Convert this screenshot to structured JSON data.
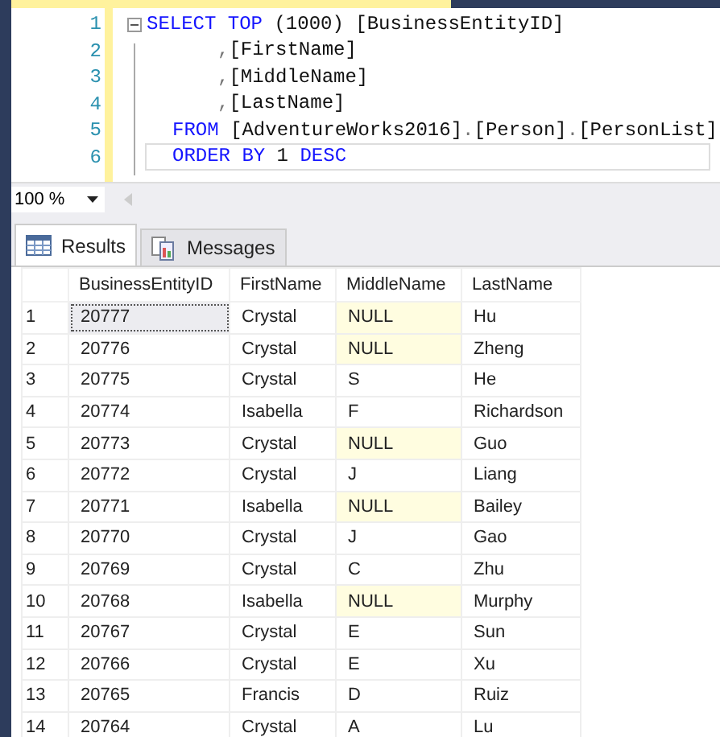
{
  "editor": {
    "lines": [
      {
        "number": "1",
        "kind": "first",
        "current": false,
        "tokens": [
          {
            "text": "SELECT TOP",
            "kind": "keyword"
          },
          {
            "text": " (1000) [BusinessEntityID]",
            "kind": "plain"
          }
        ]
      },
      {
        "number": "2",
        "kind": "continuation",
        "current": false,
        "tokens": [
          {
            "text": ",",
            "kind": "punct"
          },
          {
            "text": "[FirstName]",
            "kind": "plain"
          }
        ]
      },
      {
        "number": "3",
        "kind": "continuation",
        "current": false,
        "tokens": [
          {
            "text": ",",
            "kind": "punct"
          },
          {
            "text": "[MiddleName]",
            "kind": "plain"
          }
        ]
      },
      {
        "number": "4",
        "kind": "continuation",
        "current": false,
        "tokens": [
          {
            "text": ",",
            "kind": "punct"
          },
          {
            "text": "[LastName]",
            "kind": "plain"
          }
        ]
      },
      {
        "number": "5",
        "kind": "clause",
        "current": false,
        "tokens": [
          {
            "text": "FROM",
            "kind": "keyword"
          },
          {
            "text": " [AdventureWorks2016]",
            "kind": "plain"
          },
          {
            "text": ".",
            "kind": "punct"
          },
          {
            "text": "[Person]",
            "kind": "plain"
          },
          {
            "text": ".",
            "kind": "punct"
          },
          {
            "text": "[PersonList]",
            "kind": "plain"
          }
        ]
      },
      {
        "number": "6",
        "kind": "clause",
        "current": true,
        "tokens": [
          {
            "text": "ORDER BY",
            "kind": "keyword"
          },
          {
            "text": " 1 ",
            "kind": "plain"
          },
          {
            "text": "DESC",
            "kind": "keyword"
          }
        ]
      }
    ]
  },
  "zoom": {
    "value": "100 %"
  },
  "tabs": [
    {
      "label": "Results",
      "selected": true
    },
    {
      "label": "Messages",
      "selected": false
    }
  ],
  "grid": {
    "columns": [
      "BusinessEntityID",
      "FirstName",
      "MiddleName",
      "LastName"
    ],
    "rows": [
      {
        "number": "1",
        "focused": true,
        "null_middle": true,
        "cells": [
          "20777",
          "Crystal",
          "NULL",
          "Hu"
        ]
      },
      {
        "number": "2",
        "focused": false,
        "null_middle": true,
        "cells": [
          "20776",
          "Crystal",
          "NULL",
          "Zheng"
        ]
      },
      {
        "number": "3",
        "focused": false,
        "null_middle": false,
        "cells": [
          "20775",
          "Crystal",
          "S",
          "He"
        ]
      },
      {
        "number": "4",
        "focused": false,
        "null_middle": false,
        "cells": [
          "20774",
          "Isabella",
          "F",
          "Richardson"
        ]
      },
      {
        "number": "5",
        "focused": false,
        "null_middle": true,
        "cells": [
          "20773",
          "Crystal",
          "NULL",
          "Guo"
        ]
      },
      {
        "number": "6",
        "focused": false,
        "null_middle": false,
        "cells": [
          "20772",
          "Crystal",
          "J",
          "Liang"
        ]
      },
      {
        "number": "7",
        "focused": false,
        "null_middle": true,
        "cells": [
          "20771",
          "Isabella",
          "NULL",
          "Bailey"
        ]
      },
      {
        "number": "8",
        "focused": false,
        "null_middle": false,
        "cells": [
          "20770",
          "Crystal",
          "J",
          "Gao"
        ]
      },
      {
        "number": "9",
        "focused": false,
        "null_middle": false,
        "cells": [
          "20769",
          "Crystal",
          "C",
          "Zhu"
        ]
      },
      {
        "number": "10",
        "focused": false,
        "null_middle": true,
        "cells": [
          "20768",
          "Isabella",
          "NULL",
          "Murphy"
        ]
      },
      {
        "number": "11",
        "focused": false,
        "null_middle": false,
        "cells": [
          "20767",
          "Crystal",
          "E",
          "Sun"
        ]
      },
      {
        "number": "12",
        "focused": false,
        "null_middle": false,
        "cells": [
          "20766",
          "Crystal",
          "E",
          "Xu"
        ]
      },
      {
        "number": "13",
        "focused": false,
        "null_middle": false,
        "cells": [
          "20765",
          "Francis",
          "D",
          "Ruiz"
        ]
      },
      {
        "number": "14",
        "focused": false,
        "null_middle": false,
        "cells": [
          "20764",
          "Crystal",
          "A",
          "Lu"
        ]
      }
    ]
  }
}
